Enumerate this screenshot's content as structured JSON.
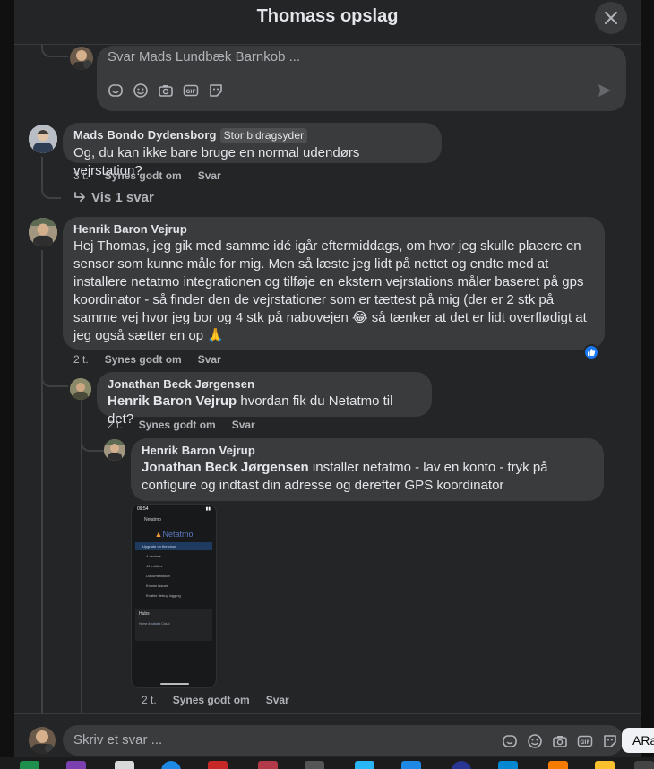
{
  "dialog": {
    "title": "Thomass opslag",
    "close_label": "Luk"
  },
  "top_reply": {
    "placeholder": "Svar Mads Lundbæk Barnkob ...",
    "tools": [
      "avatar-sticker-icon",
      "emoji-icon",
      "camera-icon",
      "gif-icon",
      "sticker-icon"
    ],
    "send_icon": "send-icon"
  },
  "comments": [
    {
      "author": "Mads Bondo Dydensborg",
      "badge": "Stor bidragsyder",
      "text": "Og, du kan ikke bare bruge en normal udendørs vejrstation?",
      "time": "3 t.",
      "like_label": "Synes godt om",
      "reply_label": "Svar",
      "show_replies": "Vis 1 svar"
    },
    {
      "author": "Henrik Baron Vejrup",
      "text": "Hej Thomas, jeg gik med samme idé igår eftermiddags, om hvor jeg skulle placere en sensor som kunne måle for mig. Men så læste jeg lidt på nettet og endte med at installere netatmo integrationen og tilføje en ekstern vejrstations måler baseret på gps koordinator - så finder den de vejrstationer som er tættest på mig (der er 2 stk på samme vej hvor jeg bor og 4 stk på nabovejen 😂 så tænker at det er lidt overflødigt at jeg også sætter en op 🙏",
      "time": "2 t.",
      "like_label": "Synes godt om",
      "reply_label": "Svar",
      "reaction": "like-icon"
    },
    {
      "author": "Jonathan Beck Jørgensen",
      "mention": "Henrik Baron Vejrup",
      "text": "hvordan fik du Netatmo til det?",
      "time": "2 t.",
      "like_label": "Synes godt om",
      "reply_label": "Svar"
    },
    {
      "author": "Henrik Baron Vejrup",
      "mention": "Jonathan Beck Jørgensen",
      "text": "installer netatmo - lav en konto - tryk på configure og indtast din adresse og derefter GPS koordinator",
      "time": "2 t.",
      "like_label": "Synes godt om",
      "reply_label": "Svar",
      "attachment": {
        "status_time": "09:54",
        "header": "Netatmo",
        "logo_text": "Netatmo",
        "items": [
          "Upgrade on the cloud",
          "4 devices",
          "41 entities",
          "Documentation",
          "Known issues",
          "Enable debug logging"
        ],
        "hubs_label": "Hubs",
        "hub_name": "Home Assistant Cloud"
      }
    }
  ],
  "bottom_reply": {
    "placeholder": "Skriv et svar ...",
    "tools": [
      "avatar-sticker-icon",
      "emoji-icon",
      "camera-icon",
      "gif-icon",
      "sticker-icon"
    ]
  },
  "side_chip": "ARa",
  "colors": {
    "surface": "#242526",
    "bubble": "#3a3b3c",
    "text": "#e4e6eb",
    "secondary": "#b0b3b8",
    "like_blue": "#1877f2"
  }
}
